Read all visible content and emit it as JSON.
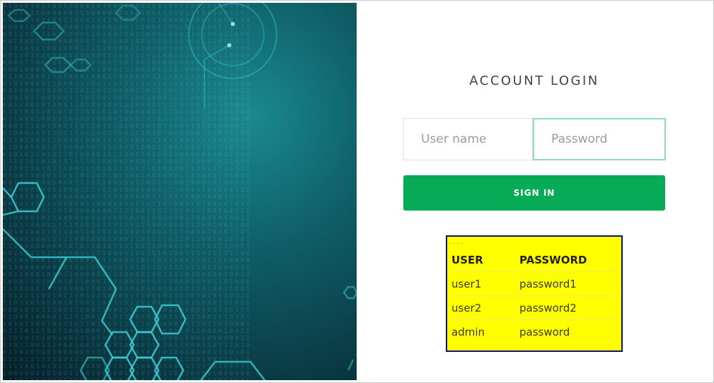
{
  "login": {
    "title": "ACCOUNT LOGIN",
    "username_placeholder": "User name",
    "password_placeholder": "Password",
    "signin_label": "SIGN IN"
  },
  "credentials": {
    "headers": [
      "USER",
      "PASSWORD"
    ],
    "rows": [
      [
        "user1",
        "password1"
      ],
      [
        "user2",
        "password2"
      ],
      [
        "admin",
        "password"
      ]
    ]
  },
  "colors": {
    "signin_button": "#07ab57",
    "password_focus_border": "#8fdcbc",
    "credentials_background": "#ffff00",
    "credentials_border": "#101080"
  }
}
